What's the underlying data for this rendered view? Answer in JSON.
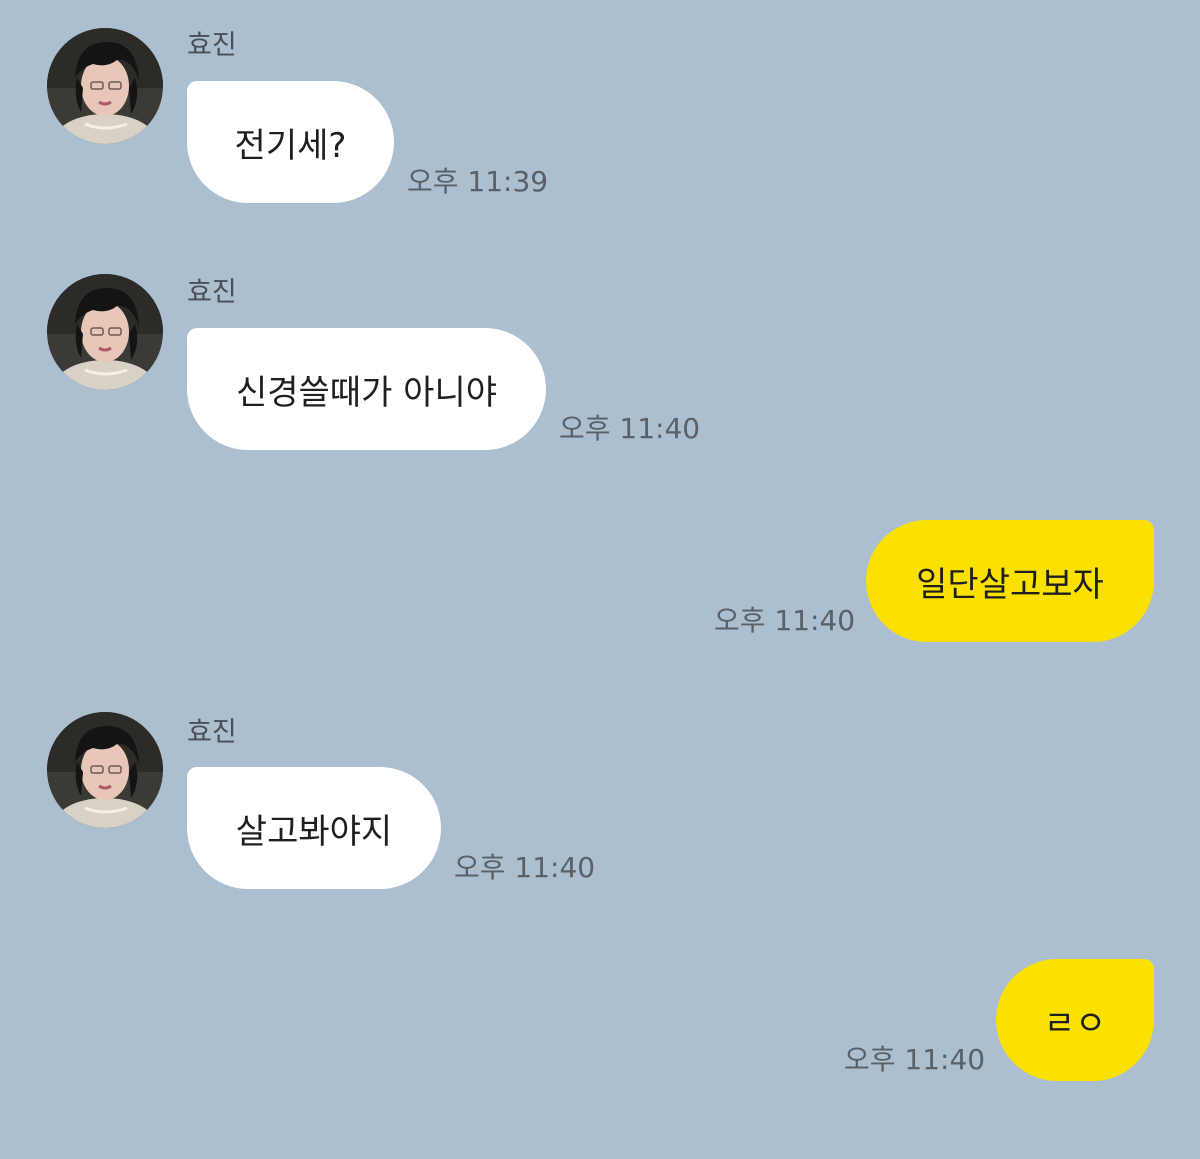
{
  "conversation": {
    "messages": [
      {
        "direction": "in",
        "sender": "효진",
        "text": "전기세?",
        "time": "오후 11:39"
      },
      {
        "direction": "in",
        "sender": "효진",
        "text": "신경쓸때가 아니야",
        "time": "오후 11:40"
      },
      {
        "direction": "out",
        "text": "일단살고보자",
        "time": "오후 11:40"
      },
      {
        "direction": "in",
        "sender": "효진",
        "text": "살고봐야지",
        "time": "오후 11:40"
      },
      {
        "direction": "out",
        "text": "ㄹㅇ",
        "time": "오후 11:40"
      }
    ]
  },
  "colors": {
    "background": "#abbfd0",
    "incoming_bubble": "#ffffff",
    "outgoing_bubble": "#fae100"
  }
}
